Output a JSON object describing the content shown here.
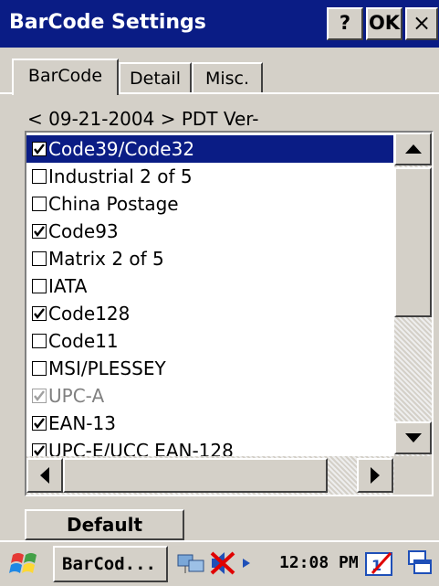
{
  "window": {
    "title": "BarCode Settings",
    "help_label": "?",
    "ok_label": "OK",
    "close_label": "×"
  },
  "tabs": [
    {
      "label": "BarCode",
      "active": true
    },
    {
      "label": "Detail",
      "active": false
    },
    {
      "label": "Misc.",
      "active": false
    }
  ],
  "version_text": "< 09-21-2004 >  PDT  Ver-",
  "barcodes": [
    {
      "label": "Code39/Code32",
      "checked": true,
      "selected": true,
      "disabled": false
    },
    {
      "label": "Industrial 2 of 5",
      "checked": false,
      "selected": false,
      "disabled": false
    },
    {
      "label": "China Postage",
      "checked": false,
      "selected": false,
      "disabled": false
    },
    {
      "label": "Code93",
      "checked": true,
      "selected": false,
      "disabled": false
    },
    {
      "label": "Matrix 2 of 5",
      "checked": false,
      "selected": false,
      "disabled": false
    },
    {
      "label": "IATA",
      "checked": false,
      "selected": false,
      "disabled": false
    },
    {
      "label": "Code128",
      "checked": true,
      "selected": false,
      "disabled": false
    },
    {
      "label": "Code11",
      "checked": false,
      "selected": false,
      "disabled": false
    },
    {
      "label": "MSI/PLESSEY",
      "checked": false,
      "selected": false,
      "disabled": false
    },
    {
      "label": "UPC-A",
      "checked": true,
      "selected": false,
      "disabled": true
    },
    {
      "label": "EAN-13",
      "checked": true,
      "selected": false,
      "disabled": false
    },
    {
      "label": "UPC-E/UCC EAN-128",
      "checked": true,
      "selected": false,
      "disabled": false
    }
  ],
  "default_button": "Default",
  "taskbar": {
    "task_label": "BarCod...",
    "clock": "12:08 PM",
    "icons": [
      "start-logo-icon",
      "network-icon",
      "sound-muted-icon",
      "input-panel-icon",
      "window-switch-icon"
    ]
  },
  "colors": {
    "title_bar": "#0a1c85",
    "selection": "#0a1c85",
    "face": "#d4d0c8"
  }
}
